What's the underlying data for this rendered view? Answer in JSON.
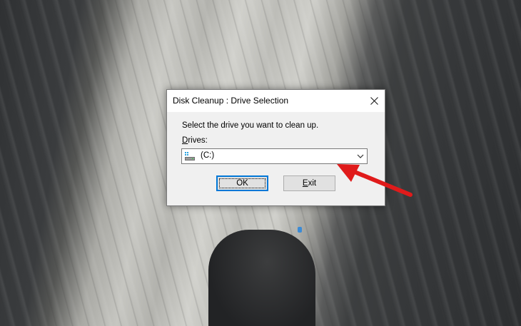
{
  "desktop": {
    "wallpaper": "rock-wall-photo"
  },
  "dialog": {
    "title": "Disk Cleanup : Drive Selection",
    "close_icon": "close-icon",
    "instruction": "Select the drive you want to clean up.",
    "drives_label_accel": "D",
    "drives_label_rest": "rives:",
    "drive_select": {
      "icon": "hard-drive-icon",
      "selected": "(C:)",
      "arrow_icon": "chevron-down-icon"
    },
    "buttons": {
      "ok": "OK",
      "exit_accel": "E",
      "exit_rest": "xit"
    }
  },
  "annotation": {
    "arrow_color": "#e01b1b",
    "points_to": "drive-select"
  },
  "colors": {
    "focus_blue": "#0078d7",
    "dialog_body": "#f0f0f0",
    "button_face": "#e1e1e1"
  }
}
